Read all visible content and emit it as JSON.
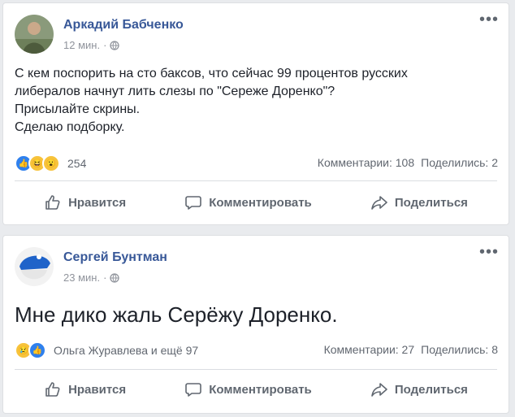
{
  "posts": [
    {
      "author": "Аркадий Бабченко",
      "time": "12 мин.",
      "text_lines": [
        "С кем поспорить на сто баксов, что сейчас 99 процентов русских",
        "либералов начнут лить слезы по \"Сереже Доренко\"?",
        "Присылайте скрины.",
        "Сделаю подборку."
      ],
      "reactions": {
        "icons": [
          "like-icon",
          "haha-icon",
          "wow-icon"
        ],
        "count_text": "254"
      },
      "comments": "Комментарии: 108",
      "shares": "Поделились: 2"
    },
    {
      "author": "Сергей Бунтман",
      "time": "23 мин.",
      "text": "Мне дико жаль Серёжу Доренко.",
      "reactions": {
        "icons": [
          "sad-icon",
          "like-icon"
        ],
        "count_text": "Ольга Журавлева и ещё 97"
      },
      "comments": "Комментарии: 27",
      "shares": "Поделились: 8"
    }
  ],
  "actions": {
    "like": "Нравится",
    "comment": "Комментировать",
    "share": "Поделиться"
  },
  "colors": {
    "author": "#385898",
    "muted": "#90949c",
    "like_blue": "#2f80ed",
    "emoji_yellow": "#f7c33b"
  }
}
